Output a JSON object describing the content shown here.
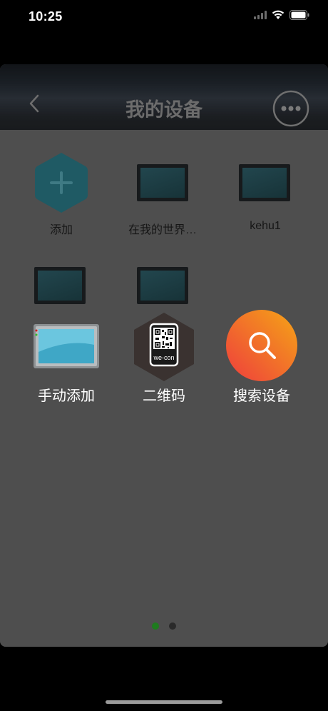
{
  "status_bar": {
    "time": "10:25"
  },
  "nav": {
    "title": "我的设备"
  },
  "devices": [
    {
      "label": "添加",
      "icon": "add-device-icon"
    },
    {
      "label": "在我的世界…",
      "icon": "hmi-screen-icon"
    },
    {
      "label": "kehu1",
      "icon": "hmi-screen-icon"
    },
    {
      "label": "",
      "icon": "hmi-screen-icon"
    },
    {
      "label": "",
      "icon": "hmi-screen-icon"
    }
  ],
  "actions": [
    {
      "label": "手动添加",
      "icon": "hmi-panel-icon"
    },
    {
      "label": "二维码",
      "icon": "qr-code-icon",
      "qr_caption": "we-con"
    },
    {
      "label": "搜索设备",
      "icon": "search-icon"
    }
  ],
  "pager": {
    "count": 2,
    "active": 0,
    "active_color": "#1e7b1e",
    "inactive_color": "#2a2a2a"
  },
  "colors": {
    "search_gradient_start": "#ee3d3d",
    "search_gradient_end": "#f5a516",
    "add_hex": "#1f5a64"
  }
}
